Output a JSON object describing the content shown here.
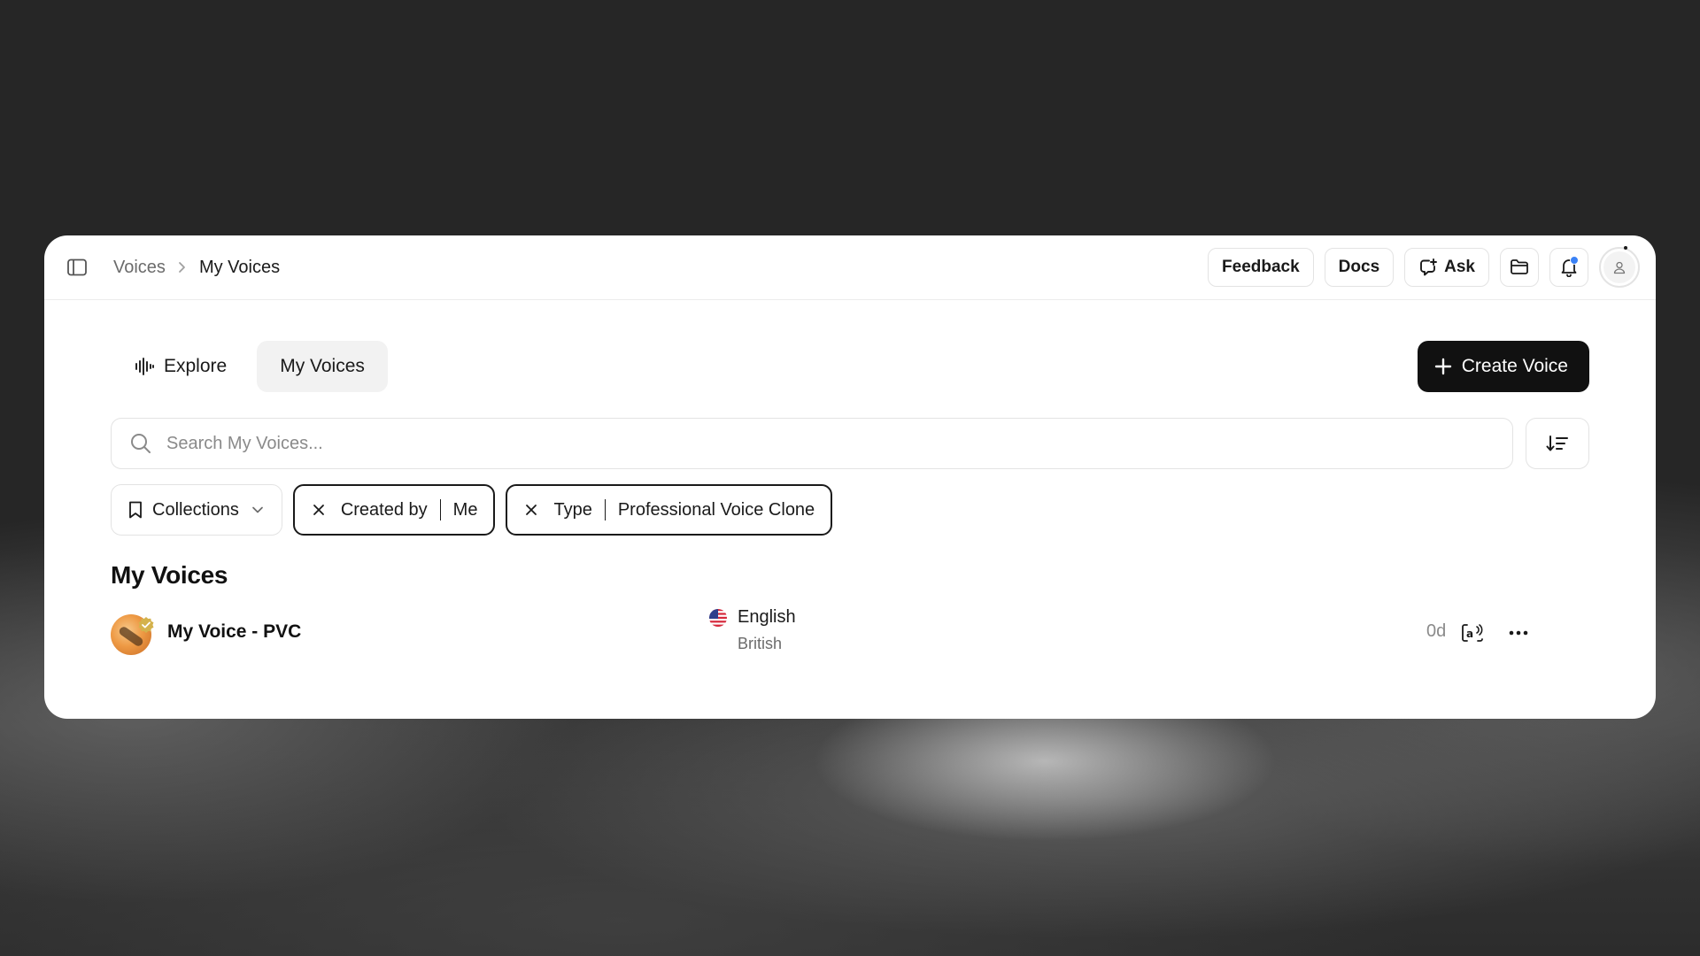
{
  "breadcrumb": {
    "parent": "Voices",
    "current": "My Voices"
  },
  "topbar": {
    "feedback_label": "Feedback",
    "docs_label": "Docs",
    "ask_label": "Ask"
  },
  "tabs": [
    {
      "label": "Explore",
      "active": false
    },
    {
      "label": "My Voices",
      "active": true
    }
  ],
  "create_button_label": "Create Voice",
  "search": {
    "placeholder": "Search My Voices..."
  },
  "filters": {
    "collections_label": "Collections",
    "created_by": {
      "key": "Created by",
      "value": "Me"
    },
    "type": {
      "key": "Type",
      "value": "Professional Voice Clone"
    }
  },
  "section_title": "My Voices",
  "voices": [
    {
      "name": "My Voice - PVC",
      "language": "English",
      "accent": "British",
      "age": "0d",
      "verified": true
    }
  ],
  "colors": {
    "accent_dark": "#111111",
    "notification_dot": "#3b82f6",
    "verified_badge": "#d4b24c"
  }
}
